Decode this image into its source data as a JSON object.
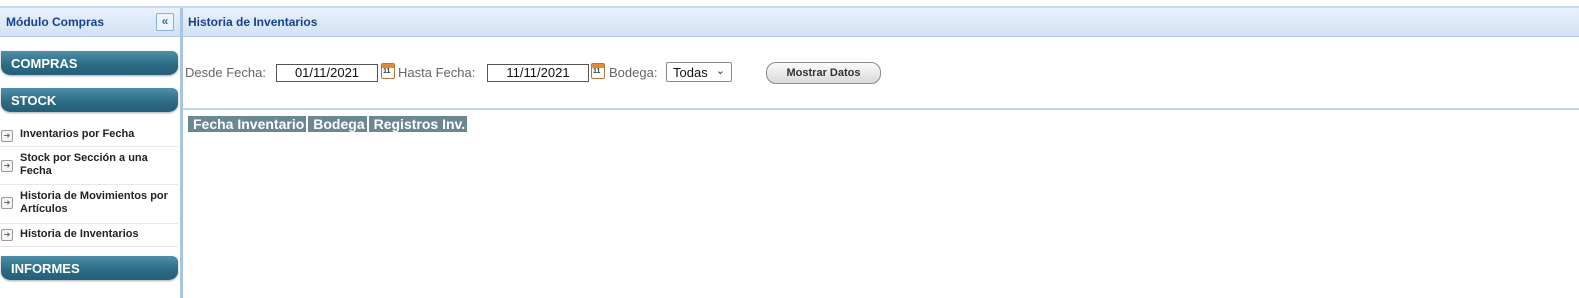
{
  "sidebar": {
    "title": "Módulo Compras",
    "collapse_icon": "«",
    "sections": {
      "compras": "COMPRAS",
      "stock": "STOCK",
      "informes": "INFORMES"
    },
    "items": [
      {
        "label": "Inventarios por Fecha"
      },
      {
        "label": "Stock por Sección a una Fecha"
      },
      {
        "label": "Historia de Movimientos por Artículos"
      },
      {
        "label": "Historia de Inventarios"
      }
    ]
  },
  "main": {
    "title": "Historia de Inventarios",
    "filters": {
      "desde_label": "Desde Fecha:",
      "desde_value": "01/11/2021",
      "hasta_label": "Hasta Fecha:",
      "hasta_value": "11/11/2021",
      "bodega_label": "Bodega:",
      "bodega_value": "Todas",
      "calendar_day": "11",
      "show_button": "Mostrar Datos"
    },
    "table": {
      "columns": [
        "Fecha Inventario",
        "Bodega",
        "Registros Inv."
      ]
    }
  },
  "icons": {
    "collapse": "double-chevron-left-icon",
    "menu_item": "arrow-right-icon",
    "calendar": "calendar-icon",
    "dropdown": "chevron-down-icon"
  },
  "colors": {
    "header_title": "#15428b",
    "section_button": "#2c6c86",
    "table_header": "#6a8792"
  }
}
